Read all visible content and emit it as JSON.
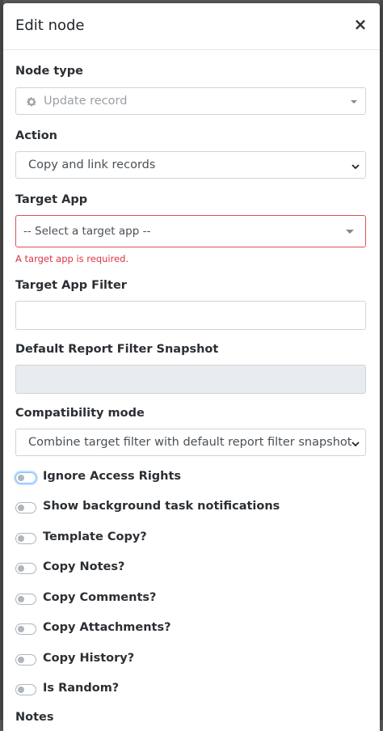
{
  "modal": {
    "title": "Edit node",
    "close_glyph": "×"
  },
  "node_type": {
    "label": "Node type",
    "value": "Update record",
    "icon": "gear-icon"
  },
  "action": {
    "label": "Action",
    "value": "Copy and link records"
  },
  "target_app": {
    "label": "Target App",
    "placeholder": "-- Select a target app --",
    "error": "A target app is required."
  },
  "target_app_filter": {
    "label": "Target App Filter",
    "value": ""
  },
  "default_report_filter": {
    "label": "Default Report Filter Snapshot",
    "value": ""
  },
  "compatibility_mode": {
    "label": "Compatibility mode",
    "value": "Combine target filter with default report filter snapshot"
  },
  "toggles": [
    {
      "label": "Ignore Access Rights",
      "checked": false
    },
    {
      "label": "Show background task notifications",
      "checked": false
    },
    {
      "label": "Template Copy?",
      "checked": false
    },
    {
      "label": "Copy Notes?",
      "checked": false
    },
    {
      "label": "Copy Comments?",
      "checked": false
    },
    {
      "label": "Copy Attachments?",
      "checked": false
    },
    {
      "label": "Copy History?",
      "checked": false
    },
    {
      "label": "Is Random?",
      "checked": false
    }
  ],
  "notes": {
    "label": "Notes"
  },
  "colors": {
    "error": "#dc3545",
    "border": "#ced4da",
    "disabled_bg": "#e9ecef"
  }
}
